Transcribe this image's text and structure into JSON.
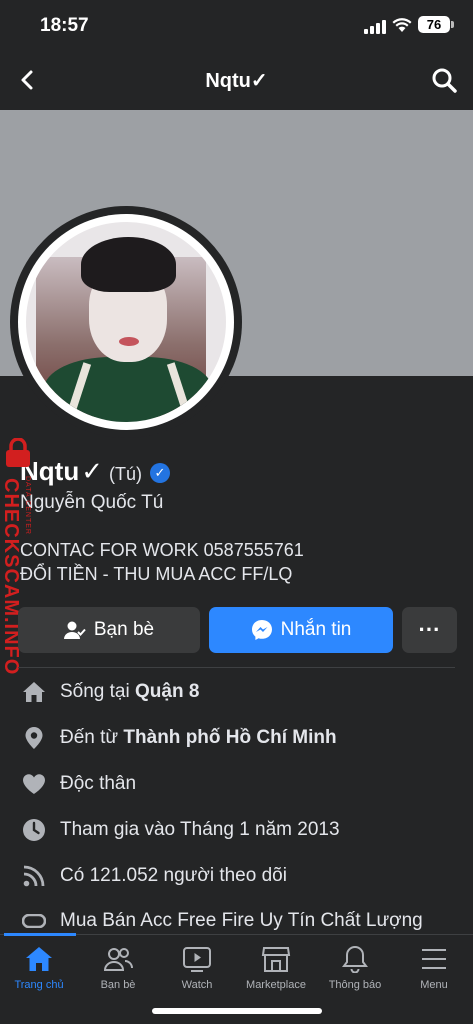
{
  "status_bar": {
    "time": "18:57",
    "battery": "76"
  },
  "nav": {
    "title": "Nqtu✓",
    "back_icon": "chevron-left-icon",
    "search_icon": "search-icon"
  },
  "profile": {
    "name": "Nqtu",
    "check_mark": "✓",
    "nickname": "(Tú)",
    "full_name": "Nguyễn Quốc Tú",
    "bio": [
      "CONTAC FOR WORK 0587555761",
      "ĐỔI TIỀN - THU MUA ACC FF/LQ"
    ]
  },
  "watermark": {
    "text": "CHECKSCAM.INFO",
    "subtext": "DATA CENTER"
  },
  "actions": {
    "friends_label": "Bạn bè",
    "message_label": "Nhắn tin",
    "more_label": "···"
  },
  "info": {
    "lives_prefix": "Sống tại ",
    "lives_value": "Quận 8",
    "from_prefix": "Đến từ ",
    "from_value": "Thành phố Hồ Chí Minh",
    "relationship": "Độc thân",
    "joined": "Tham gia vào Tháng 1 năm 2013",
    "followers": "Có 121.052 người theo dõi",
    "extra": "Mua Bán Acc Free Fire Uy Tín Chất Lượng"
  },
  "tabs": [
    {
      "label": "Trang chủ",
      "icon": "home-icon",
      "active": true
    },
    {
      "label": "Bạn bè",
      "icon": "friends-icon"
    },
    {
      "label": "Watch",
      "icon": "watch-icon"
    },
    {
      "label": "Marketplace",
      "icon": "marketplace-icon"
    },
    {
      "label": "Thông báo",
      "icon": "bell-icon"
    },
    {
      "label": "Menu",
      "icon": "menu-icon"
    }
  ],
  "colors": {
    "background": "#242526",
    "accent": "#2d88ff",
    "cover": "#9da0a4",
    "watermark": "#d21f1f"
  }
}
